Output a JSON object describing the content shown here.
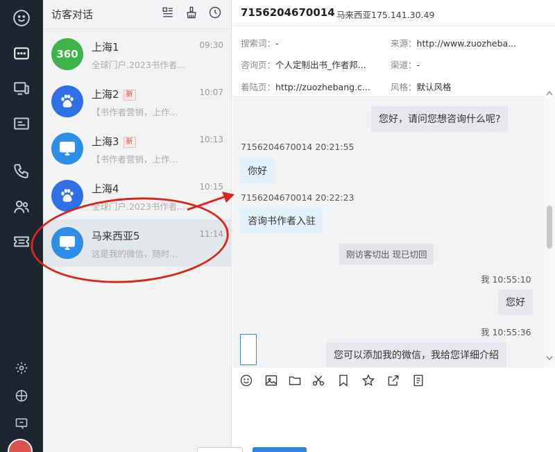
{
  "rail": {
    "items": [
      "logo-icon",
      "chat-icon",
      "devices-icon",
      "card-icon",
      "phone-icon",
      "contacts-icon",
      "ticket-icon"
    ],
    "bottom": [
      "settings-icon",
      "globe-icon",
      "feedback-icon"
    ]
  },
  "list": {
    "title": "访客对话",
    "visitors": [
      {
        "name": "上海1",
        "time": "09:30",
        "msg": "全球门户.2023书作者...",
        "new": "",
        "source": "360"
      },
      {
        "name": "上海2",
        "time": "10:07",
        "msg": "【书作者营销，上作...",
        "new": "新",
        "source": "baidu"
      },
      {
        "name": "上海3",
        "time": "10:13",
        "msg": "【书作者营销，上作...",
        "new": "新",
        "source": "pc"
      },
      {
        "name": "上海4",
        "time": "10:15",
        "msg": "全球门户.2023书作者...",
        "new": "",
        "source": "baidu"
      },
      {
        "name": "马来西亚5",
        "time": "11:14",
        "msg": "这是我的微信，随时...",
        "new": "",
        "source": "pc"
      }
    ],
    "source_label_360": "360"
  },
  "chat": {
    "header": {
      "id": "7156204670014",
      "sub": "马来西亚175.141.30.49"
    },
    "info": {
      "search_key": "搜索词：",
      "search_val": "-",
      "source_key": "来源：",
      "source_val": "http://www.zuozheba...",
      "consult_key": "咨询页：",
      "consult_val": "个人定制出书_作者邦...",
      "channel_key": "渠道：",
      "channel_val": "-",
      "landing_key": "着陆页：",
      "landing_val": "http://zuozhebang.c...",
      "style_key": "风格：",
      "style_val": "默认风格"
    },
    "messages": {
      "m1_text": "您好，请问您想咨询什么呢?",
      "m2_time": "7156204670014 20:21:55",
      "m2_text": "你好",
      "m3_time": "7156204670014 20:22:23",
      "m3_text": "咨询书作者入驻",
      "system": "刚访客切出 现已切回",
      "m4_time": "我 10:55:10",
      "m4_text": "您好",
      "m5_time": "我 10:55:36",
      "m5_text": "您可以添加我的微信，我给您详细介绍"
    },
    "toolbar": [
      "emoji-icon",
      "image-icon",
      "folder-icon",
      "scissors-icon",
      "bookmark-icon",
      "star-icon",
      "share-icon",
      "document-icon"
    ]
  },
  "colors": {
    "rail": "#1c2530",
    "accent": "#2f86e0",
    "annotation": "#d6271e"
  }
}
